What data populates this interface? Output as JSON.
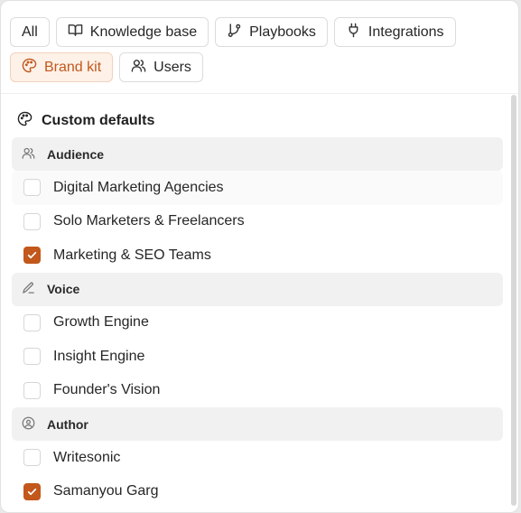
{
  "colors": {
    "accent": "#c2581c",
    "accent_bg": "#fdf1e8"
  },
  "tabs_row1": [
    {
      "label": "All",
      "icon": ""
    },
    {
      "label": "Knowledge base",
      "icon": "book-icon"
    },
    {
      "label": "Playbooks",
      "icon": "branch-icon"
    },
    {
      "label": "Integrations",
      "icon": "plug-icon"
    }
  ],
  "tabs_row2": [
    {
      "label": "Brand kit",
      "icon": "palette-icon",
      "active": true
    },
    {
      "label": "Users",
      "icon": "users-icon"
    }
  ],
  "section": {
    "title": "Custom defaults",
    "icon": "palette-icon"
  },
  "groups": [
    {
      "label": "Audience",
      "icon": "users-icon",
      "options": [
        {
          "label": "Digital Marketing Agencies",
          "checked": false
        },
        {
          "label": "Solo Marketers & Freelancers",
          "checked": false
        },
        {
          "label": "Marketing & SEO Teams",
          "checked": true
        }
      ]
    },
    {
      "label": "Voice",
      "icon": "pen-icon",
      "options": [
        {
          "label": "Growth Engine",
          "checked": false
        },
        {
          "label": "Insight Engine",
          "checked": false
        },
        {
          "label": "Founder's Vision",
          "checked": false
        }
      ]
    },
    {
      "label": "Author",
      "icon": "user-circle-icon",
      "options": [
        {
          "label": "Writesonic",
          "checked": false
        },
        {
          "label": "Samanyou Garg",
          "checked": true
        }
      ]
    }
  ]
}
